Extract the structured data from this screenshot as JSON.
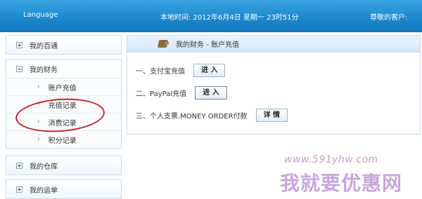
{
  "header": {
    "language": "Language",
    "local_time": "本地时间: 2012年6月4日 星期一 23时51分",
    "greeting": "尊敬的客户:"
  },
  "sidebar": {
    "sections": [
      {
        "label": "我的百通",
        "state": "collapsed"
      },
      {
        "label": "我的财务",
        "state": "expanded",
        "items": [
          "账户充值",
          "充值记录",
          "消费记录",
          "积分记录"
        ]
      },
      {
        "label": "我的仓库",
        "state": "collapsed"
      },
      {
        "label": "我的运单",
        "state": "collapsed"
      }
    ]
  },
  "main": {
    "breadcrumb": "我的财务 - 账户充值",
    "options": [
      {
        "label": "一、支付宝充值",
        "button": "进 入"
      },
      {
        "label": "二、PayPal充值",
        "button": "进 入"
      },
      {
        "label": "三、个人支票,MONEY ORDER付款",
        "button": "详 情"
      }
    ]
  },
  "annotation": {
    "color": "#c0262b"
  },
  "watermark": {
    "url": "www.591yhw.com",
    "text": "我就要优惠网"
  }
}
